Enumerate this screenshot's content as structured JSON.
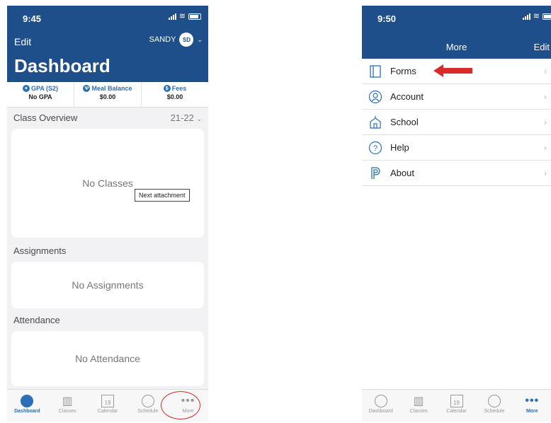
{
  "left": {
    "status_time": "9:45",
    "edit": "Edit",
    "user": "SANDY",
    "avatar_initials": "SD",
    "title": "Dashboard",
    "summary": [
      {
        "label": "GPA (S2)",
        "value": "No GPA",
        "icon": "graduation-icon"
      },
      {
        "label": "Meal Balance",
        "value": "$0.00",
        "icon": "utensils-icon"
      },
      {
        "label": "Fees",
        "value": "$0.00",
        "icon": "dollar-icon"
      }
    ],
    "class_overview": "Class Overview",
    "term": "21-22",
    "no_classes": "No Classes",
    "tooltip": "Next attachment",
    "assignments": "Assignments",
    "no_assignments": "No Assignments",
    "attendance": "Attendance",
    "no_attendance": "No Attendance"
  },
  "tabs": {
    "dashboard": "Dashboard",
    "classes": "Classes",
    "calendar": "Calendar",
    "calendar_day": "19",
    "schedule": "Schedule",
    "more": "More"
  },
  "right": {
    "status_time": "9:50",
    "title": "More",
    "edit": "Edit",
    "items": [
      {
        "label": "Forms",
        "icon": "forms-icon"
      },
      {
        "label": "Account",
        "icon": "account-icon"
      },
      {
        "label": "School",
        "icon": "school-icon"
      },
      {
        "label": "Help",
        "icon": "help-icon"
      },
      {
        "label": "About",
        "icon": "about-icon"
      }
    ]
  },
  "colors": {
    "header": "#1f4f8a",
    "accent": "#2a6fb8",
    "annotation": "#d92b2b"
  }
}
